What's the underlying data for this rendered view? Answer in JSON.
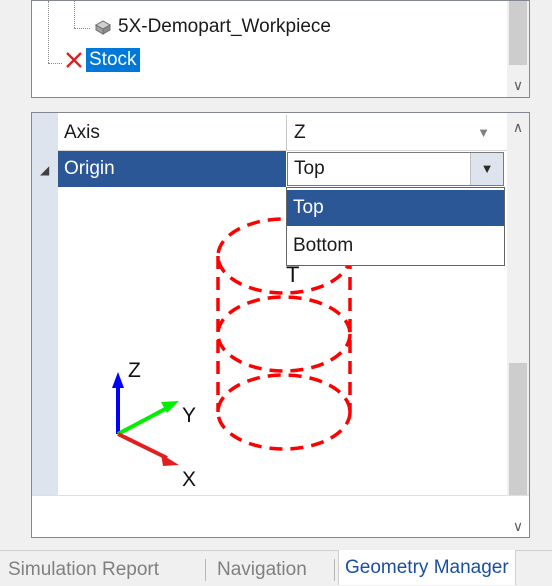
{
  "tree": {
    "workpiece_label": "5X-Demopart_Workpiece",
    "stock_label": "Stock"
  },
  "properties": {
    "axis": {
      "name": "Axis",
      "value": "Z"
    },
    "origin": {
      "name": "Origin",
      "value": "Top"
    }
  },
  "dropdown": {
    "options": [
      "Top",
      "Bottom"
    ],
    "selected": "Top"
  },
  "preview": {
    "axes": {
      "z": "Z",
      "y": "Y",
      "x": "X"
    },
    "origin_marker": "T",
    "colors": {
      "stock_outline": "#ff0000",
      "z_axis": "#0000ff",
      "y_axis": "#00ff00",
      "x_axis": "#e02020"
    }
  },
  "tabs": {
    "items": [
      "Simulation Report",
      "Navigation",
      "Geometry Manager"
    ],
    "active": "Geometry Manager"
  },
  "colors": {
    "selection": "#0078d7",
    "grid_selection": "#2b5797"
  }
}
